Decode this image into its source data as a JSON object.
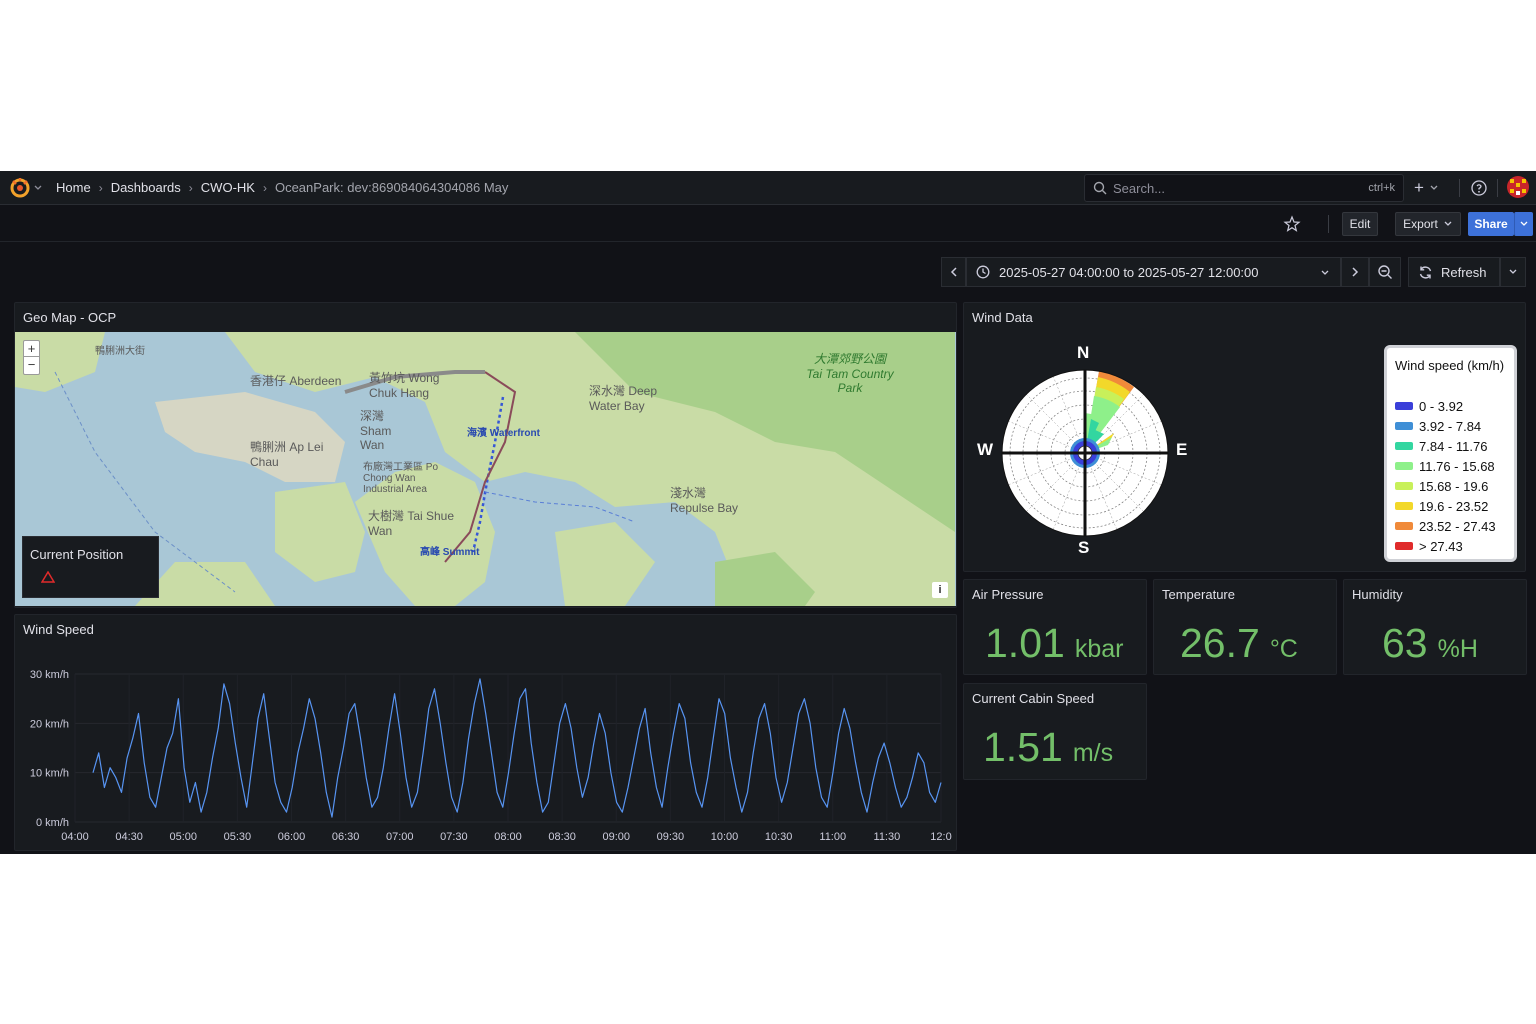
{
  "breadcrumb": [
    "Home",
    "Dashboards",
    "CWO-HK",
    "OceanPark: dev:869084064304086 May"
  ],
  "search": {
    "placeholder": "Search...",
    "shortcut": "ctrl+k"
  },
  "toolbar": {
    "edit": "Edit",
    "export": "Export",
    "share": "Share"
  },
  "time_range": {
    "label": "2025-05-27 04:00:00 to 2025-05-27 12:00:00",
    "refresh": "Refresh"
  },
  "geomap": {
    "title": "Geo Map - OCP",
    "current_position_label": "Current Position",
    "labels": [
      {
        "t": "鴨脷洲大街"
      },
      {
        "t": "香港仔 Aberdeen"
      },
      {
        "t": "黃竹坑 Wong Chuk Hang"
      },
      {
        "t": "深灣 Sham Wan"
      },
      {
        "t": "鴨脷洲 Ap Lei Chau"
      },
      {
        "t": "布廠灣工業區 Po Chong Wan Industrial Area"
      },
      {
        "t": "大樹灣 Tai Shue Wan"
      },
      {
        "t": "深水灣 Deep Water Bay"
      },
      {
        "t": "淺水灣 Repulse Bay"
      },
      {
        "t": "大潭郊野公園 Tai Tam Country Park"
      },
      {
        "t": "海濱 Waterfront"
      },
      {
        "t": "高峰 Summit"
      }
    ]
  },
  "wind_data": {
    "title": "Wind Data",
    "compass": {
      "n": "N",
      "e": "E",
      "s": "S",
      "w": "W"
    },
    "legend_title": "Wind speed (km/h)",
    "legend": [
      {
        "label": "0 - 3.92",
        "color": "#3a3fd9"
      },
      {
        "label": "3.92 - 7.84",
        "color": "#3f8fd6"
      },
      {
        "label": "7.84 - 11.76",
        "color": "#33d6a0"
      },
      {
        "label": "11.76 - 15.68",
        "color": "#8ef08a"
      },
      {
        "label": "15.68 - 19.6",
        "color": "#c8f05a"
      },
      {
        "label": "19.6 - 23.52",
        "color": "#f2d82a"
      },
      {
        "label": "23.52 - 27.43",
        "color": "#f08a3a"
      },
      {
        "label": "> 27.43",
        "color": "#e02b2b"
      }
    ]
  },
  "stats": {
    "air_pressure": {
      "title": "Air Pressure",
      "value": "1.01",
      "unit": "kbar"
    },
    "temperature": {
      "title": "Temperature",
      "value": "26.7",
      "unit": "°C"
    },
    "humidity": {
      "title": "Humidity",
      "value": "63",
      "unit": "%H"
    },
    "cabin_speed": {
      "title": "Current Cabin Speed",
      "value": "1.51",
      "unit": "m/s"
    }
  },
  "wind_speed": {
    "title": "Wind Speed",
    "y_ticks": [
      "30 km/h",
      "20 km/h",
      "10 km/h",
      "0 km/h"
    ],
    "x_ticks": [
      "04:00",
      "04:30",
      "05:00",
      "05:30",
      "06:00",
      "06:30",
      "07:00",
      "07:30",
      "08:00",
      "08:30",
      "09:00",
      "09:30",
      "10:00",
      "10:30",
      "11:00",
      "11:30",
      "12:0"
    ],
    "ylim": [
      0,
      30
    ],
    "line_color": "#5794f2"
  },
  "chart_data": {
    "type": "line",
    "title": "Wind Speed",
    "xlabel": "",
    "ylabel": "",
    "ylim": [
      0,
      30
    ],
    "x_range": [
      "04:00",
      "12:00"
    ],
    "series": [
      {
        "values": [
          10,
          14,
          7,
          11,
          9,
          6,
          13,
          17,
          22,
          12,
          5,
          3,
          9,
          15,
          18,
          25,
          11,
          4,
          8,
          2,
          6,
          13,
          19,
          28,
          24,
          16,
          9,
          3,
          12,
          21,
          26,
          17,
          8,
          4,
          2,
          7,
          14,
          19,
          25,
          21,
          14,
          6,
          1,
          9,
          15,
          22,
          24,
          17,
          9,
          3,
          5,
          11,
          19,
          26,
          18,
          9,
          3,
          6,
          14,
          23,
          27,
          20,
          12,
          5,
          2,
          8,
          17,
          24,
          29,
          22,
          14,
          6,
          3,
          10,
          18,
          25,
          27,
          16,
          8,
          2,
          4,
          12,
          20,
          24,
          19,
          11,
          5,
          9,
          16,
          22,
          18,
          10,
          4,
          2,
          7,
          13,
          19,
          23,
          14,
          7,
          3,
          11,
          18,
          24,
          21,
          12,
          6,
          3,
          9,
          17,
          25,
          22,
          13,
          7,
          2,
          6,
          14,
          21,
          24,
          18,
          9,
          4,
          8,
          15,
          22,
          25,
          20,
          11,
          5,
          3,
          10,
          18,
          23,
          19,
          12,
          6,
          2,
          8,
          13,
          16,
          12,
          7,
          3,
          5,
          9,
          14,
          12,
          6,
          4,
          8
        ]
      }
    ]
  }
}
